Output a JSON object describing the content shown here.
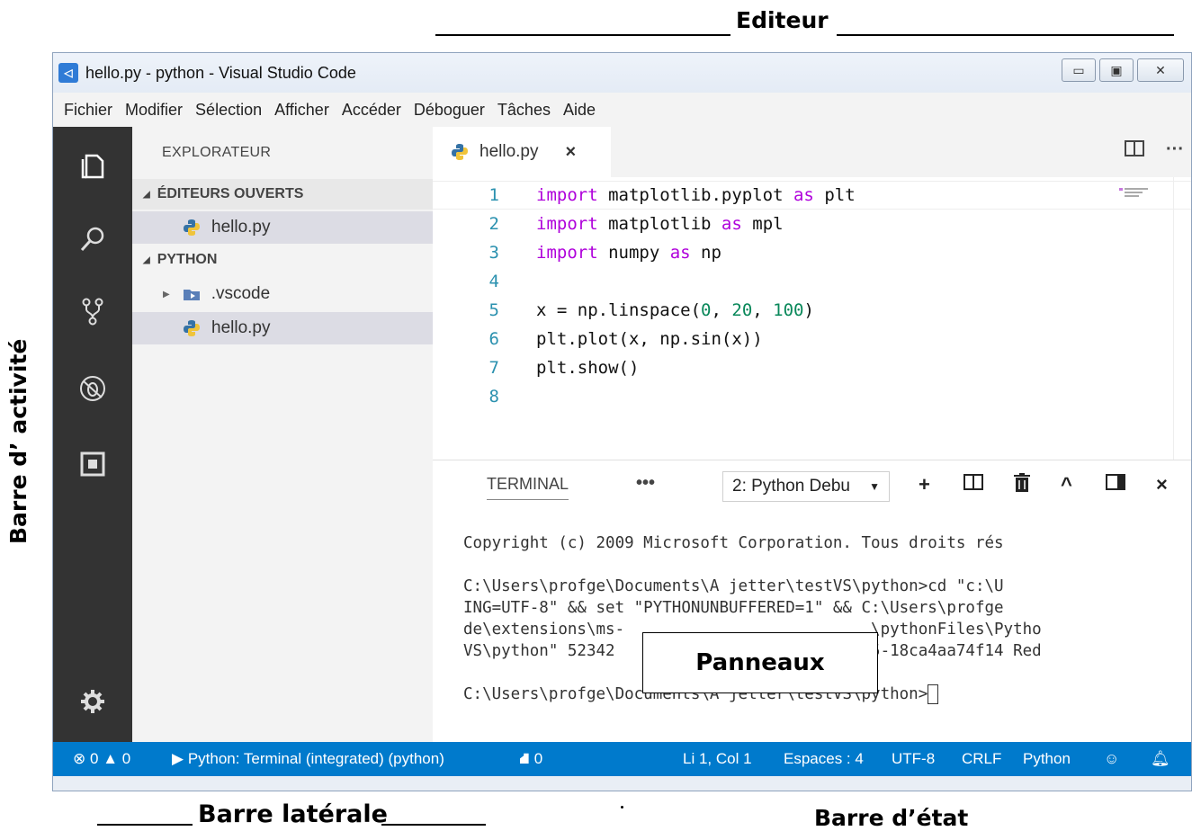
{
  "annotations": {
    "editeur": "Editeur",
    "barre_activite": "Barre d’ activité",
    "barre_laterale": "Barre latérale",
    "barre_etat": "Barre d’état",
    "panneaux": "Panneaux"
  },
  "window": {
    "title": "hello.py - python - Visual Studio Code",
    "minimize": "▭",
    "maximize": "▣",
    "close": "✕"
  },
  "menu": [
    "Fichier",
    "Modifier",
    "Sélection",
    "Afficher",
    "Accéder",
    "Déboguer",
    "Tâches",
    "Aide"
  ],
  "activity_bar": [
    "files-icon",
    "search-icon",
    "source-control-icon",
    "debug-icon",
    "extensions-icon",
    "gear-icon"
  ],
  "sidebar": {
    "title": "EXPLORATEUR",
    "open_editors": "ÉDITEURS OUVERTS",
    "open_file": "hello.py",
    "folder": "PYTHON",
    "vscode_folder": ".vscode",
    "file": "hello.py"
  },
  "editor": {
    "tab_label": "hello.py",
    "tab_close": "×",
    "split_icon": "split-editor-icon",
    "more": "···",
    "lines": [
      {
        "n": "1",
        "parts": [
          [
            "kw",
            "import"
          ],
          [
            "t",
            " matplotlib.pyplot "
          ],
          [
            "kw",
            "as"
          ],
          [
            "t",
            " plt"
          ]
        ]
      },
      {
        "n": "2",
        "parts": [
          [
            "kw",
            "import"
          ],
          [
            "t",
            " matplotlib "
          ],
          [
            "kw",
            "as"
          ],
          [
            "t",
            " mpl"
          ]
        ]
      },
      {
        "n": "3",
        "parts": [
          [
            "kw",
            "import"
          ],
          [
            "t",
            " numpy "
          ],
          [
            "kw",
            "as"
          ],
          [
            "t",
            " np"
          ]
        ]
      },
      {
        "n": "4",
        "parts": []
      },
      {
        "n": "5",
        "parts": [
          [
            "t",
            "x = np.linspace("
          ],
          [
            "num",
            "0"
          ],
          [
            "t",
            ", "
          ],
          [
            "num",
            "20"
          ],
          [
            "t",
            ", "
          ],
          [
            "num",
            "100"
          ],
          [
            "t",
            ")"
          ]
        ]
      },
      {
        "n": "6",
        "parts": [
          [
            "t",
            "plt.plot(x, np.sin(x))"
          ]
        ]
      },
      {
        "n": "7",
        "parts": [
          [
            "t",
            "plt.show()"
          ]
        ]
      },
      {
        "n": "8",
        "parts": []
      }
    ]
  },
  "panel": {
    "tab": "TERMINAL",
    "more": "•••",
    "selected_terminal": "2: Python Debu",
    "terminal_lines": [
      "Copyright (c) 2009 Microsoft Corporation. Tous droits rés",
      "",
      "C:\\Users\\profge\\Documents\\A jetter\\testVS\\python>cd \"c:\\U",
      "ING=UTF-8\" && set \"PYTHONUNBUFFERED=1\" && C:\\Users\\profge",
      "de\\extensions\\ms-                          \\pythonFiles\\Pytho",
      "VS\\python\" 52342                           5-18ca4aa74f14 Red",
      "",
      "C:\\Users\\profge\\Documents\\A jetter\\testVS\\python>"
    ]
  },
  "status": {
    "errors": "0",
    "warnings": "0",
    "run_target": "Python: Terminal (integrated) (python)",
    "tasks": "0",
    "position": "Li 1, Col 1",
    "spaces": "Espaces : 4",
    "encoding": "UTF-8",
    "eol": "CRLF",
    "language": "Python"
  },
  "colors": {
    "accent": "#007acc",
    "activity_bar": "#333333",
    "keyword": "#af00db",
    "number": "#09885a"
  }
}
